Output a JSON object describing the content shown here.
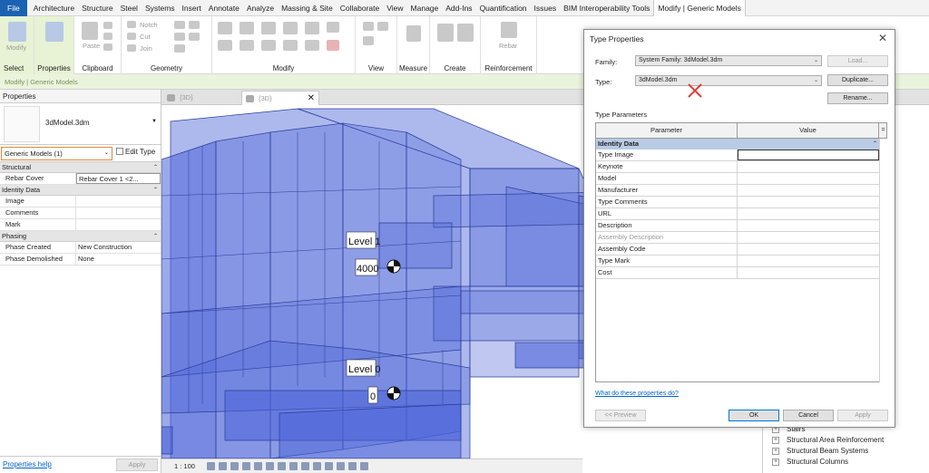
{
  "menu": {
    "tabs": [
      "File",
      "Architecture",
      "Structure",
      "Steel",
      "Systems",
      "Insert",
      "Annotate",
      "Analyze",
      "Massing & Site",
      "Collaborate",
      "View",
      "Manage",
      "Add-Ins",
      "Quantification",
      "Issues",
      "BIM Interoperability Tools",
      "Modify | Generic Models"
    ],
    "active_tab": "Modify | Generic Models"
  },
  "ribbon": {
    "groups": [
      "Select",
      "Properties",
      "Clipboard",
      "Geometry",
      "Modify",
      "View",
      "Measure",
      "Create",
      "Reinforcement"
    ],
    "select_label": "Select",
    "modify_label": "Modify",
    "properties_label": "Properties",
    "paste_label": "Paste",
    "rebar_label": "Rebar",
    "notch": "Notch",
    "cut": "Cut",
    "join": "Join"
  },
  "context_bar": "Modify | Generic Models",
  "properties_panel": {
    "title": "Properties",
    "type_name": "3dModel.3dm",
    "selector": "Generic Models (1)",
    "edit_type": "Edit Type",
    "sections": [
      {
        "name": "Structural",
        "rows": [
          {
            "name": "Rebar Cover",
            "value": "Rebar Cover 1 <2..."
          }
        ]
      },
      {
        "name": "Identity Data",
        "rows": [
          {
            "name": "Image",
            "value": ""
          },
          {
            "name": "Comments",
            "value": ""
          },
          {
            "name": "Mark",
            "value": ""
          }
        ]
      },
      {
        "name": "Phasing",
        "rows": [
          {
            "name": "Phase Created",
            "value": "New Construction"
          },
          {
            "name": "Phase Demolished",
            "value": "None"
          }
        ]
      }
    ],
    "help_link": "Properties help",
    "apply": "Apply"
  },
  "view_tabs": [
    {
      "label": "{3D}"
    },
    {
      "label": "{3D}",
      "active": true
    }
  ],
  "canvas": {
    "level1_name": "Level 1",
    "level1_elev": "4000",
    "level0_name": "Level 0",
    "level0_elev": "0"
  },
  "status": {
    "scale": "1 : 100"
  },
  "project_browser": {
    "items": [
      "Stairs",
      "Structural Area Reinforcement",
      "Structural Beam Systems",
      "Structural Columns"
    ]
  },
  "dialog": {
    "title": "Type Properties",
    "family_label": "Family:",
    "family_value": "System Family: 3dModel.3dm",
    "type_label": "Type:",
    "type_value": "3dModel.3dm",
    "load": "Load...",
    "duplicate": "Duplicate...",
    "rename": "Rename...",
    "type_params_label": "Type Parameters",
    "col_parameter": "Parameter",
    "col_value": "Value",
    "col_extra": "=",
    "section": "Identity Data",
    "rows": [
      {
        "name": "Type Image",
        "dim": false
      },
      {
        "name": "Keynote",
        "dim": false
      },
      {
        "name": "Model",
        "dim": false
      },
      {
        "name": "Manufacturer",
        "dim": false
      },
      {
        "name": "Type Comments",
        "dim": false
      },
      {
        "name": "URL",
        "dim": false
      },
      {
        "name": "Description",
        "dim": false
      },
      {
        "name": "Assembly Description",
        "dim": true
      },
      {
        "name": "Assembly Code",
        "dim": false
      },
      {
        "name": "Type Mark",
        "dim": false
      },
      {
        "name": "Cost",
        "dim": false
      }
    ],
    "help_link": "What do these properties do?",
    "preview": "<< Preview",
    "ok": "OK",
    "cancel": "Cancel",
    "apply": "Apply"
  },
  "colors": {
    "accent": "#1b62b2",
    "selection": "#e7f3d4",
    "model_fill": "#4a62d8",
    "mark": "#e53935"
  }
}
